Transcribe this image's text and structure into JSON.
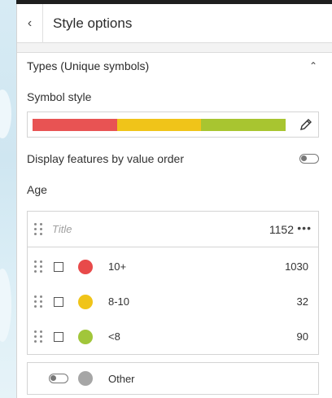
{
  "header": {
    "back_icon": "chevron-left-icon",
    "title": "Style options"
  },
  "section": {
    "title": "Types (Unique symbols)",
    "collapse_icon": "chevron-up-icon"
  },
  "symbol_style": {
    "label": "Symbol style",
    "ramp_colors": [
      "#e85353",
      "#f0c419",
      "#a8c530"
    ],
    "edit_icon": "pencil-icon"
  },
  "display_order": {
    "label": "Display features by value order",
    "enabled": false
  },
  "field": {
    "label": "Age"
  },
  "list": {
    "title_placeholder": "Title",
    "total": "1152",
    "more_icon": "ellipsis-icon",
    "items": [
      {
        "label": "10+",
        "count": "1030",
        "color": "#e84a4a",
        "checked": false
      },
      {
        "label": "8-10",
        "count": "32",
        "color": "#f0c419",
        "checked": false
      },
      {
        "label": "<8",
        "count": "90",
        "color": "#a1c63a",
        "checked": false
      }
    ]
  },
  "other": {
    "label": "Other",
    "color": "#a6a6a6",
    "enabled": false
  }
}
